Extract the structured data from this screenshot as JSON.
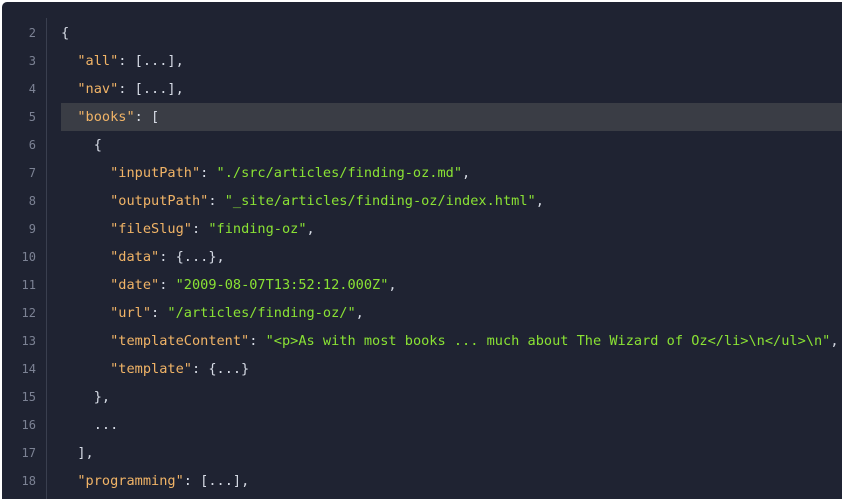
{
  "lines": [
    {
      "num": "2",
      "indent": "",
      "parts": [
        {
          "t": "{",
          "c": "p"
        }
      ]
    },
    {
      "num": "3",
      "indent": "  ",
      "parts": [
        {
          "t": "\"all\"",
          "c": "k"
        },
        {
          "t": ": [...],",
          "c": "p"
        }
      ]
    },
    {
      "num": "4",
      "indent": "  ",
      "parts": [
        {
          "t": "\"nav\"",
          "c": "k"
        },
        {
          "t": ": [...],",
          "c": "p"
        }
      ]
    },
    {
      "num": "5",
      "indent": "  ",
      "highlight": true,
      "parts": [
        {
          "t": "\"books\"",
          "c": "k"
        },
        {
          "t": ": [",
          "c": "p"
        }
      ]
    },
    {
      "num": "6",
      "indent": "    ",
      "parts": [
        {
          "t": "{",
          "c": "p"
        }
      ]
    },
    {
      "num": "7",
      "indent": "      ",
      "parts": [
        {
          "t": "\"inputPath\"",
          "c": "k"
        },
        {
          "t": ": ",
          "c": "p"
        },
        {
          "t": "\"./src/articles/finding-oz.md\"",
          "c": "s"
        },
        {
          "t": ",",
          "c": "p"
        }
      ]
    },
    {
      "num": "8",
      "indent": "      ",
      "parts": [
        {
          "t": "\"outputPath\"",
          "c": "k"
        },
        {
          "t": ": ",
          "c": "p"
        },
        {
          "t": "\"_site/articles/finding-oz/index.html\"",
          "c": "s"
        },
        {
          "t": ",",
          "c": "p"
        }
      ]
    },
    {
      "num": "9",
      "indent": "      ",
      "parts": [
        {
          "t": "\"fileSlug\"",
          "c": "k"
        },
        {
          "t": ": ",
          "c": "p"
        },
        {
          "t": "\"finding-oz\"",
          "c": "s"
        },
        {
          "t": ",",
          "c": "p"
        }
      ]
    },
    {
      "num": "10",
      "indent": "      ",
      "parts": [
        {
          "t": "\"data\"",
          "c": "k"
        },
        {
          "t": ": {...},",
          "c": "p"
        }
      ]
    },
    {
      "num": "11",
      "indent": "      ",
      "parts": [
        {
          "t": "\"date\"",
          "c": "k"
        },
        {
          "t": ": ",
          "c": "p"
        },
        {
          "t": "\"2009-08-07T13:52:12.000Z\"",
          "c": "s"
        },
        {
          "t": ",",
          "c": "p"
        }
      ]
    },
    {
      "num": "12",
      "indent": "      ",
      "parts": [
        {
          "t": "\"url\"",
          "c": "k"
        },
        {
          "t": ": ",
          "c": "p"
        },
        {
          "t": "\"/articles/finding-oz/\"",
          "c": "s"
        },
        {
          "t": ",",
          "c": "p"
        }
      ]
    },
    {
      "num": "13",
      "indent": "      ",
      "parts": [
        {
          "t": "\"templateContent\"",
          "c": "k"
        },
        {
          "t": ": ",
          "c": "p"
        },
        {
          "t": "\"<p>As with most books ... much about The Wizard of Oz</li>\\n</ul>\\n\"",
          "c": "s"
        },
        {
          "t": ",",
          "c": "p"
        }
      ]
    },
    {
      "num": "14",
      "indent": "      ",
      "parts": [
        {
          "t": "\"template\"",
          "c": "k"
        },
        {
          "t": ": {...}",
          "c": "p"
        }
      ]
    },
    {
      "num": "15",
      "indent": "    ",
      "parts": [
        {
          "t": "},",
          "c": "p"
        }
      ]
    },
    {
      "num": "16",
      "indent": "    ",
      "parts": [
        {
          "t": "...",
          "c": "p"
        }
      ]
    },
    {
      "num": "17",
      "indent": "  ",
      "parts": [
        {
          "t": "],",
          "c": "p"
        }
      ]
    },
    {
      "num": "18",
      "indent": "  ",
      "parts": [
        {
          "t": "\"programming\"",
          "c": "k"
        },
        {
          "t": ": [...],",
          "c": "p"
        }
      ]
    }
  ],
  "colors": {
    "background": "#1f2332",
    "key": "#f1b467",
    "string": "#8ae234",
    "punctuation": "#d6dbe5",
    "line_number": "#7c8294",
    "highlight": "#3a3d45"
  }
}
